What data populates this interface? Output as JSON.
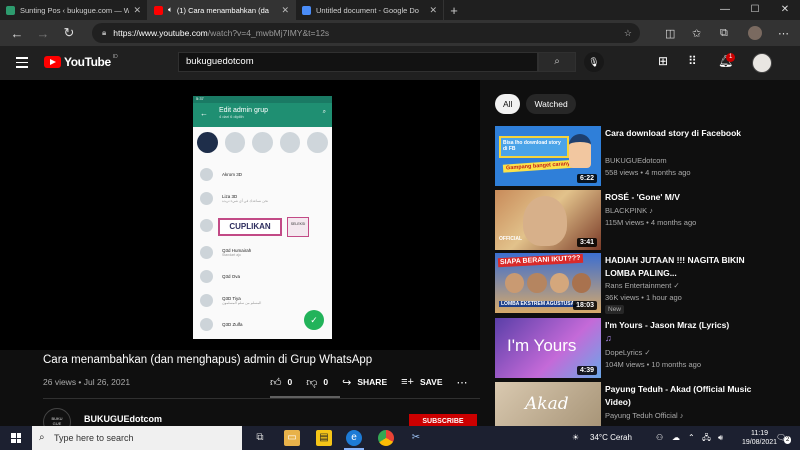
{
  "browser": {
    "tabs": [
      {
        "title": "Sunting Pos ‹ bukugue.com — W",
        "fav_color": "#2d9b6e"
      },
      {
        "title": "(1) Cara menambahkan (da",
        "fav_color": "#ff0000"
      },
      {
        "title": "Untitled document - Google Do",
        "fav_color": "#4a8cf7"
      }
    ],
    "url_host": "https://www.youtube.com",
    "url_path": "/watch?v=4_mwbMj7IMY&t=12s"
  },
  "youtube": {
    "logo_text": "YouTube",
    "logo_region": "ID",
    "search_value": "bukuguedotcom",
    "notification_count": "1"
  },
  "video": {
    "title": "Cara menambahkan (dan menghapus) admin di Grup WhatsApp",
    "meta": "26 views • Jul 26, 2021",
    "likes": "0",
    "dislikes": "0",
    "share_label": "SHARE",
    "save_label": "SAVE",
    "channel": "BUKUGUEdotcom",
    "subscribe_label": "SUBSCRIBE",
    "overlay_label": "CUPLIKAN",
    "overlay_badge": "SELEKSI",
    "phone": {
      "header": "Edit admin grup",
      "header_sub": "4 dari 6 dipilih",
      "contacts": [
        {
          "name": "Akrom 3D",
          "sub": ""
        },
        {
          "name": "Liza 3D",
          "sub": "نحن نساعدك في أي شيء تريده"
        },
        {
          "name": "Q3d Humairah",
          "sub": "Standart ajo"
        },
        {
          "name": "Q3d Ova",
          "sub": ""
        },
        {
          "name": "Q3D Tiya",
          "sub": "المسلم من سلم المسلمون"
        },
        {
          "name": "Q3D Zulfa",
          "sub": ""
        }
      ]
    }
  },
  "chips": [
    {
      "label": "All",
      "selected": true
    },
    {
      "label": "Watched",
      "selected": false
    }
  ],
  "recommendations": [
    {
      "title": "Cara download story di Facebook",
      "channel": "BUKUGUEdotcom",
      "stats": "558 views • 4 months ago",
      "duration": "6:22",
      "badge": "",
      "verified": "",
      "thumb_text": "Gampang banget caranya!!"
    },
    {
      "title": "ROSÉ - 'Gone' M/V",
      "channel": "BLACKPINK",
      "stats": "115M views • 4 months ago",
      "duration": "3:41",
      "badge": "",
      "verified": "♪",
      "thumb_text": "OFFICIAL"
    },
    {
      "title": "HADIAH JUTAAN !!! NAGITA BIKIN LOMBA PALING...",
      "channel": "Rans Entertainment",
      "stats": "36K views • 1 hour ago",
      "duration": "18:03",
      "badge": "New",
      "verified": "✓",
      "thumb_text": "SIAPA BERANI IKUT???"
    },
    {
      "title": "I'm Yours - Jason Mraz (Lyrics)",
      "channel": "DopeLyrics",
      "stats": "104M views • 10 months ago",
      "duration": "4:39",
      "badge": "",
      "verified": "✓",
      "thumb_text": "I'm Yours",
      "extra": "♫"
    },
    {
      "title": "Payung Teduh - Akad (Official Music Video)",
      "channel": "Payung Teduh Official",
      "stats": "",
      "duration": "",
      "badge": "",
      "verified": "♪",
      "thumb_text": "Akad"
    }
  ],
  "taskbar": {
    "search_placeholder": "Type here to search",
    "weather": "34°C  Cerah",
    "time": "11:19",
    "date": "19/08/2021",
    "notif_count": "2"
  }
}
